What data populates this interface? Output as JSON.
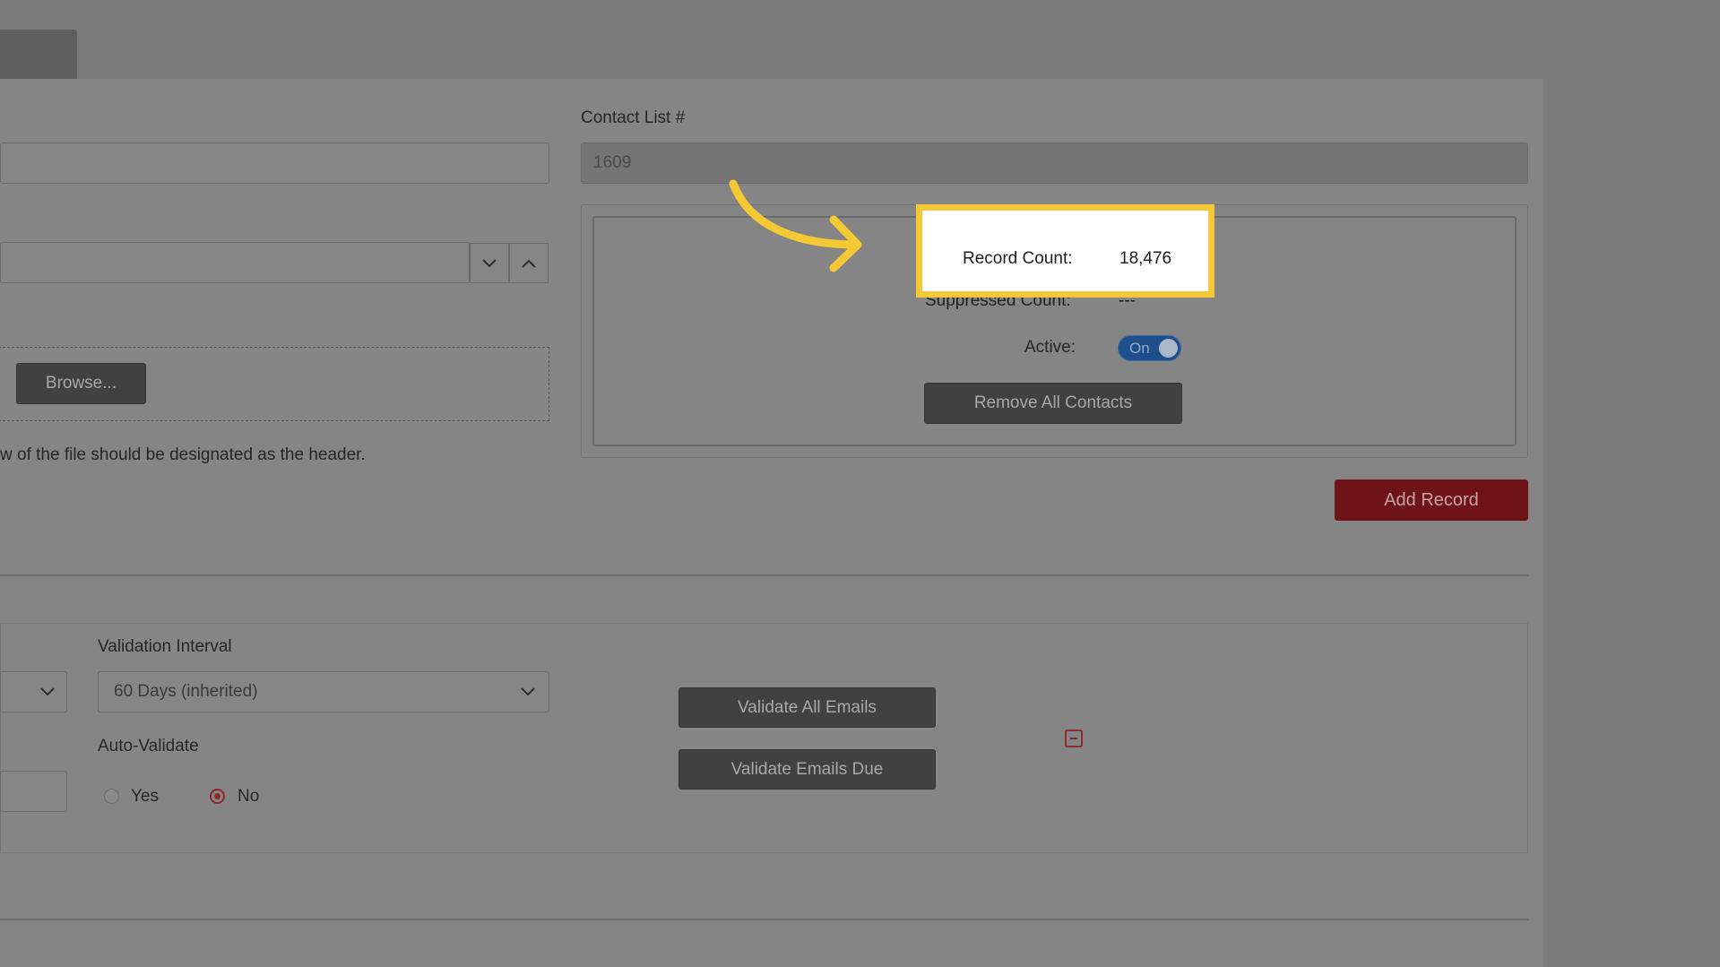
{
  "contact_list": {
    "label": "Contact List #",
    "value": "1609"
  },
  "file_upload": {
    "browse_label": "Browse...",
    "hint": "w of the file should be designated as the header."
  },
  "stats": {
    "record_count_label": "Record Count:",
    "record_count_value": "18,476",
    "suppressed_label": "Suppressed Count:",
    "suppressed_value": "---",
    "active_label": "Active:",
    "active_toggle": "On",
    "remove_all_label": "Remove All Contacts"
  },
  "add_record_label": "Add Record",
  "validation": {
    "interval_label": "Validation Interval",
    "interval_value": "60 Days (inherited)",
    "auto_label": "Auto-Validate",
    "yes_label": "Yes",
    "no_label": "No",
    "validate_all_label": "Validate All Emails",
    "validate_due_label": "Validate Emails Due"
  },
  "icons": {
    "chevron_down": "chevron-down-icon",
    "chevron_up": "chevron-up-icon",
    "collapse": "minus-square-icon",
    "arrow": "curved-arrow-icon"
  },
  "colors": {
    "highlight": "#f4c933",
    "accent_red": "#6e1418",
    "toggle_blue": "#1e4f8a"
  }
}
